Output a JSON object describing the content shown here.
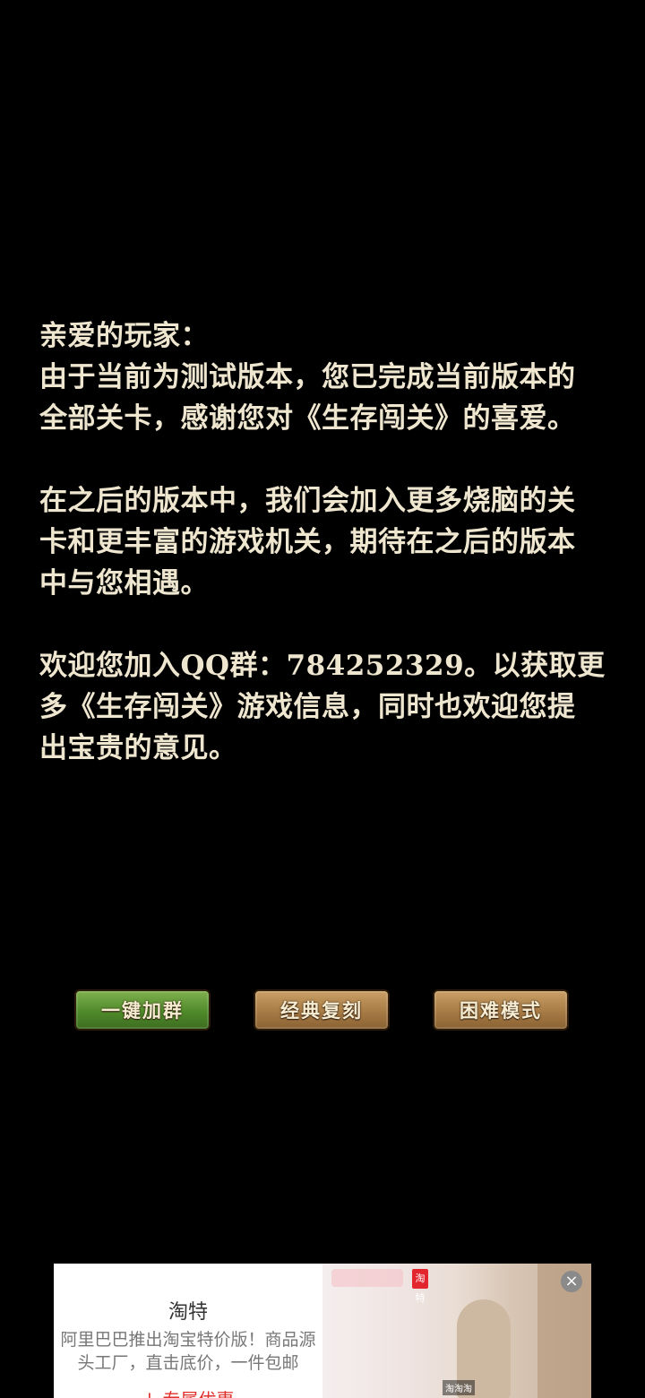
{
  "message": {
    "greeting": "亲爱的玩家：",
    "paragraph1": "由于当前为测试版本，您已完成当前版本的\n全部关卡，感谢您对《生存闯关》的喜爱。",
    "paragraph2": "在之后的版本中，我们会加入更多烧脑的关\n卡和更丰富的游戏机关，期待在之后的版本\n中与您相遇。",
    "paragraph3": "欢迎您加入QQ群：784252329。以获取更\n多《生存闯关》游戏信息，同时也欢迎您提\n出宝贵的意见。"
  },
  "buttons": {
    "join_group": "一键加群",
    "classic_replay": "经典复刻",
    "hard_mode": "困难模式"
  },
  "ad": {
    "title": "淘特",
    "description": "阿里巴巴推出淘宝特价版！商品源头工厂，直击底价，一件包邮",
    "cta": "↓ 专属优惠",
    "badge": "淘特",
    "caption": "淘淘淘",
    "close_symbol": "×"
  }
}
